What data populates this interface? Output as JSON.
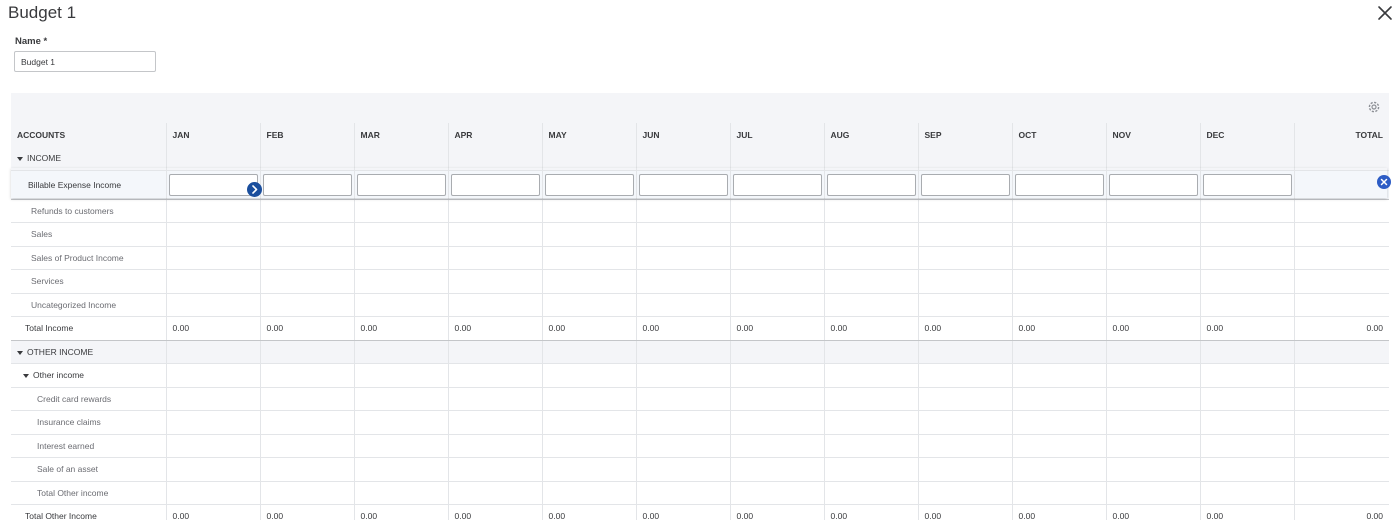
{
  "window": {
    "title": "Budget 1"
  },
  "form": {
    "name_label": "Name *",
    "name_value": "Budget 1"
  },
  "columns": [
    "ACCOUNTS",
    "JAN",
    "FEB",
    "MAR",
    "APR",
    "MAY",
    "JUN",
    "JUL",
    "AUG",
    "SEP",
    "OCT",
    "NOV",
    "DEC",
    "TOTAL"
  ],
  "sections": {
    "income": {
      "label": "INCOME",
      "edit_row_label": "Billable Expense Income",
      "accounts": [
        "Refunds to customers",
        "Sales",
        "Sales of Product Income",
        "Services",
        "Uncategorized Income"
      ],
      "total_label": "Total Income",
      "total_values": [
        "0.00",
        "0.00",
        "0.00",
        "0.00",
        "0.00",
        "0.00",
        "0.00",
        "0.00",
        "0.00",
        "0.00",
        "0.00",
        "0.00",
        "0.00"
      ]
    },
    "other_income": {
      "label": "OTHER INCOME",
      "subgroup_label": "Other income",
      "accounts": [
        "Credit card rewards",
        "Insurance claims",
        "Interest earned",
        "Sale of an asset"
      ],
      "subgroup_total_label": "Total Other income",
      "total_label": "Total Other Income",
      "total_values": [
        "0.00",
        "0.00",
        "0.00",
        "0.00",
        "0.00",
        "0.00",
        "0.00",
        "0.00",
        "0.00",
        "0.00",
        "0.00",
        "0.00",
        "0.00"
      ]
    }
  },
  "icons": {
    "close": "close-icon",
    "gear": "gear-icon",
    "next": "chevron-right-icon",
    "clear": "clear-icon"
  },
  "colors": {
    "accent": "#1a4e9d",
    "header_bg": "#f4f5f8",
    "border": "#e3e5e8"
  }
}
